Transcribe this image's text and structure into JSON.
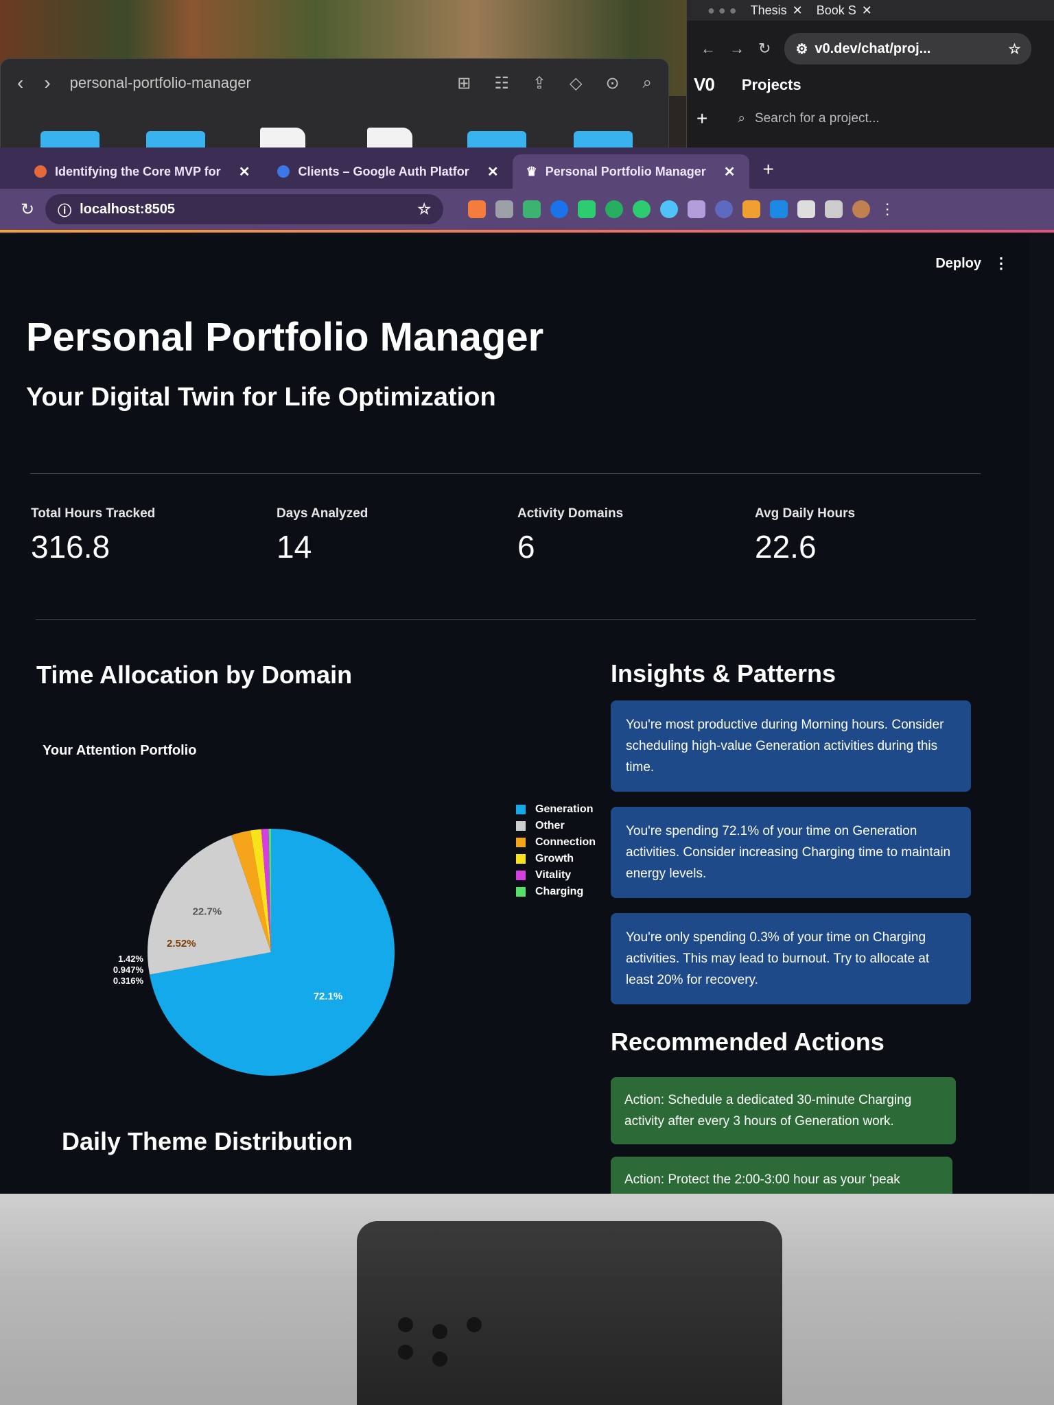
{
  "finder": {
    "title": "personal-portfolio-manager"
  },
  "v0": {
    "tabs": [
      "Thesis",
      "Book S"
    ],
    "url": "v0.dev/chat/proj...",
    "section_title": "Projects",
    "search_placeholder": "Search for a project..."
  },
  "browser": {
    "tabs": [
      {
        "label": "Identifying the Core MVP for"
      },
      {
        "label": "Clients – Google Auth Platfor"
      },
      {
        "label": "Personal Portfolio Manager"
      }
    ],
    "address": "localhost:8505"
  },
  "app": {
    "deploy_label": "Deploy",
    "title": "Personal Portfolio Manager",
    "subtitle": "Your Digital Twin for Life Optimization",
    "metrics": [
      {
        "label": "Total Hours Tracked",
        "value": "316.8"
      },
      {
        "label": "Days Analyzed",
        "value": "14"
      },
      {
        "label": "Activity Domains",
        "value": "6"
      },
      {
        "label": "Avg Daily Hours",
        "value": "22.6"
      }
    ],
    "time_section_title": "Time Allocation by Domain",
    "insights_title": "Insights & Patterns",
    "insights": [
      "You're most productive during Morning hours. Consider scheduling high-value Generation activities during this time.",
      "You're spending 72.1% of your time on Generation activities. Consider increasing Charging time to maintain energy levels.",
      "You're only spending 0.3% of your time on Charging activities. This may lead to burnout. Try to allocate at least 20% for recovery."
    ],
    "actions_title": "Recommended Actions",
    "actions": [
      "Action: Schedule a dedicated 30-minute Charging activity after every 3 hours of Generation work.",
      "Action: Protect the 2:00-3:00 hour as your 'peak"
    ],
    "daily_title": "Daily Theme Distribution"
  },
  "chart_data": {
    "type": "pie",
    "title": "Your Attention Portfolio",
    "slices": [
      {
        "label": "Generation",
        "value": 72.1,
        "display": "72.1%",
        "color": "#14a9ea"
      },
      {
        "label": "Other",
        "value": 22.7,
        "display": "22.7%",
        "color": "#cfcfcf"
      },
      {
        "label": "Connection",
        "value": 2.52,
        "display": "2.52%",
        "color": "#f6a51a"
      },
      {
        "label": "Growth",
        "value": 1.42,
        "display": "1.42%",
        "color": "#f7e21b"
      },
      {
        "label": "Vitality",
        "value": 0.947,
        "display": "0.947%",
        "color": "#d43fe0"
      },
      {
        "label": "Charging",
        "value": 0.316,
        "display": "0.316%",
        "color": "#56e06a"
      }
    ],
    "legend_position": "right"
  }
}
